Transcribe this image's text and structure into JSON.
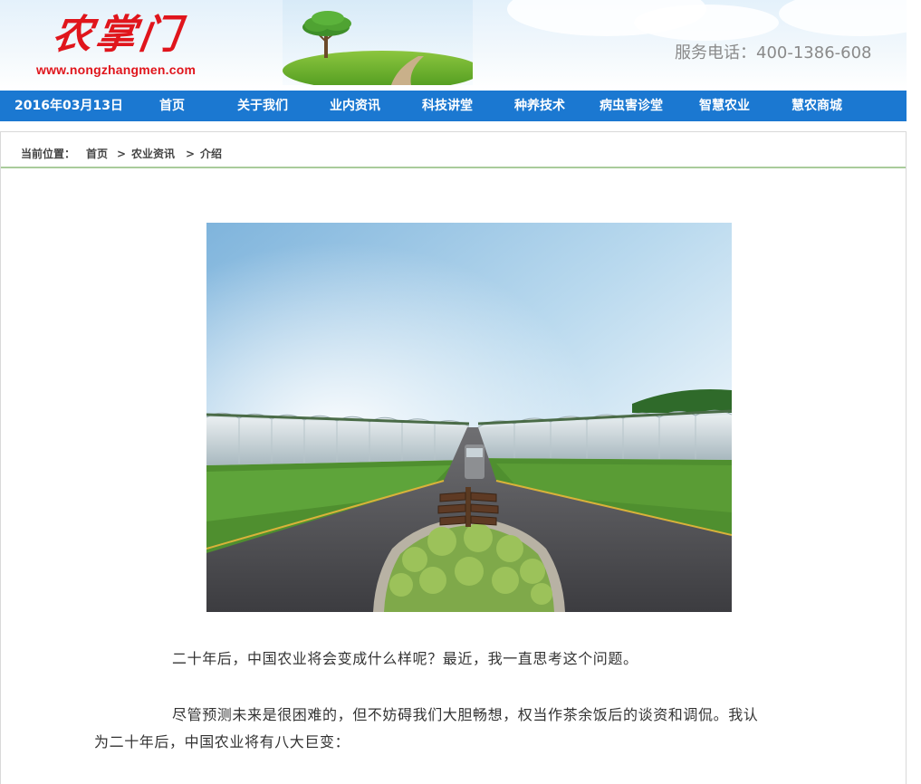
{
  "header": {
    "logo_text": "农掌门",
    "logo_url": "www.nongzhangmen.com",
    "hotline": "服务电话：400-1386-608"
  },
  "nav": {
    "date": "2016年03月13日",
    "items": [
      "首页",
      "关于我们",
      "业内资讯",
      "科技讲堂",
      "种养技术",
      "病虫害诊堂",
      "智慧农业",
      "慧农商城"
    ]
  },
  "breadcrumb": {
    "label": "当前位置：",
    "home": "首页",
    "sep": ">",
    "category": "农业资讯",
    "current": "介绍"
  },
  "article": {
    "para1": "二十年后，中国农业将会变成什么样呢？最近，我一直思考这个问题。",
    "para2_line1": "尽管预测未来是很困难的，但不妨碍我们大胆畅想，权当作茶余饭后的谈资和调侃。我认",
    "para2_line2": "为二十年后，中国农业将有八大巨变："
  },
  "colors": {
    "nav_bg": "#1b78d1",
    "logo_red": "#e0151c",
    "breadcrumb_rule": "#a9cc9b"
  }
}
